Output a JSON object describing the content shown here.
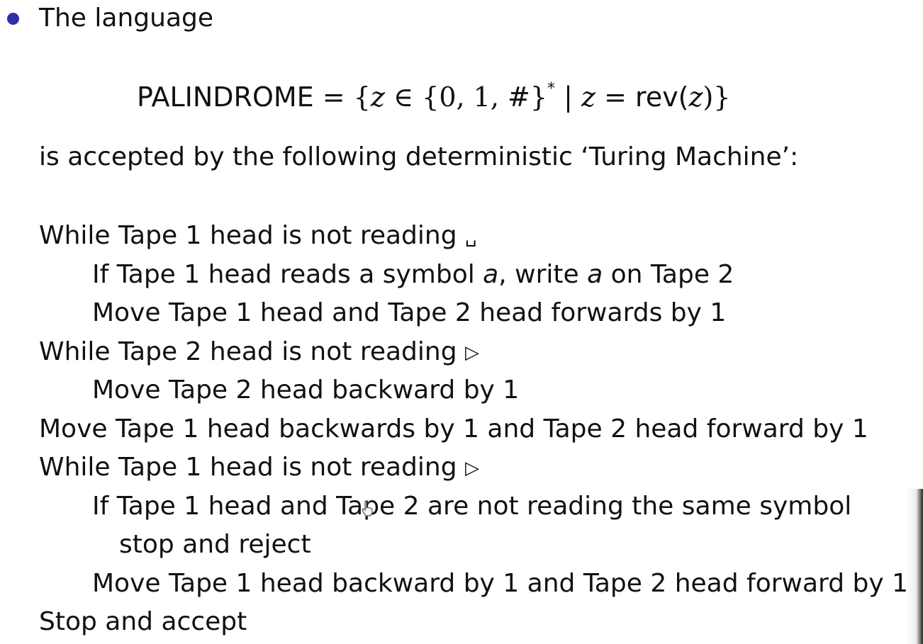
{
  "slide": {
    "intro": "The language",
    "formula": {
      "name": "PALINDROME",
      "eq1": " = {",
      "var1": "z",
      "in": " ∈ {0, 1, #}",
      "star": "*",
      "bar": " | ",
      "var2": "z",
      "eq2": " = ",
      "rev": "rev(",
      "var3": "z",
      "close": ")}"
    },
    "accepted": "is accepted by the following deterministic ‘Turing Machine’:",
    "algorithm": {
      "line1_text": "While Tape 1 head is not reading ",
      "line1_symbol": "␣",
      "line2_a": "If Tape 1 head reads a symbol ",
      "line2_var1": "a",
      "line2_b": ", write ",
      "line2_var2": "a",
      "line2_c": " on Tape 2",
      "line3": "Move Tape 1 head and Tape 2 head forwards by 1",
      "line4_text": "While Tape 2 head is not reading ",
      "line4_symbol": "▷",
      "line5": "Move Tape 2 head backward by 1",
      "line6": "Move Tape 1 head backwards by 1 and Tape 2 head forward by 1",
      "line7_text": "While Tape 1 head is not reading ",
      "line7_symbol": "▷",
      "line8": "If Tape 1 head and Tape 2 are not reading the same symbol",
      "line9": "stop and reject",
      "line10": "Move Tape 1 head backward by 1 and Tape 2 head forward by 1",
      "line11": "Stop and accept"
    },
    "colors": {
      "bullet": "#2f2fa8",
      "text": "#111111",
      "background": "#ffffff"
    },
    "icons": {
      "cursor": "hand-cursor-icon"
    }
  }
}
